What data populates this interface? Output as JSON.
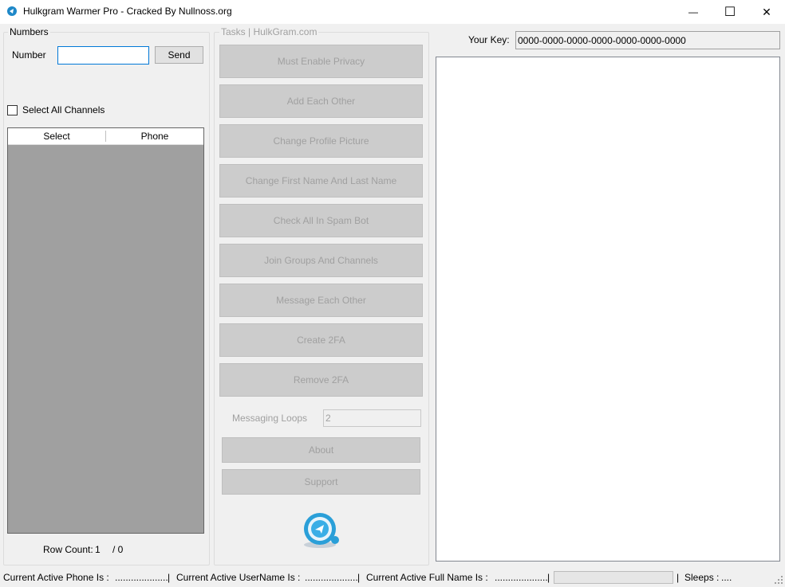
{
  "window": {
    "title": "Hulkgram Warmer Pro - Cracked By Nullnoss.org",
    "minimize_glyph": "—",
    "maximize_glyph": "☐",
    "close_glyph": "✕"
  },
  "numbers": {
    "legend": "Numbers",
    "number_label": "Number",
    "number_value": "",
    "send_label": "Send",
    "select_all_label": "Select All Channels",
    "select_all_checked": false,
    "grid_headers": [
      "Select",
      "Phone"
    ],
    "row_count_label": "Row Count:",
    "row_count_value": "1",
    "row_count_total": "/ 0"
  },
  "tasks": {
    "legend": "Tasks | HulkGram.com",
    "buttons": [
      "Must Enable Privacy",
      "Add Each Other",
      "Change Profile Picture",
      "Change First Name And Last Name",
      "Check All In Spam Bot",
      "Join Groups And Channels",
      "Message Each Other",
      "Create 2FA",
      "Remove 2FA"
    ],
    "messaging_loops_label": "Messaging Loops",
    "messaging_loops_value": "2",
    "about_label": "About",
    "support_label": "Support",
    "logo_icon": "telegram-logo-icon"
  },
  "key": {
    "label": "Your Key:",
    "value": "0000-0000-0000-0000-0000-0000-0000"
  },
  "status": {
    "phone_label": "Current Active Phone Is :",
    "phone_value": "....................",
    "sep": "|",
    "username_label": "Current Active UserName Is :",
    "username_value": "....................",
    "fullname_label": "Current Active Full Name Is :",
    "fullname_value": "....................",
    "sleeps_label": "Sleeps :",
    "sleeps_value": "....",
    "progress": 0
  },
  "colors": {
    "grid_bg": "#a0a0a0",
    "disabled_text": "#a0a0a0",
    "disabled_bg": "#cccccc"
  }
}
